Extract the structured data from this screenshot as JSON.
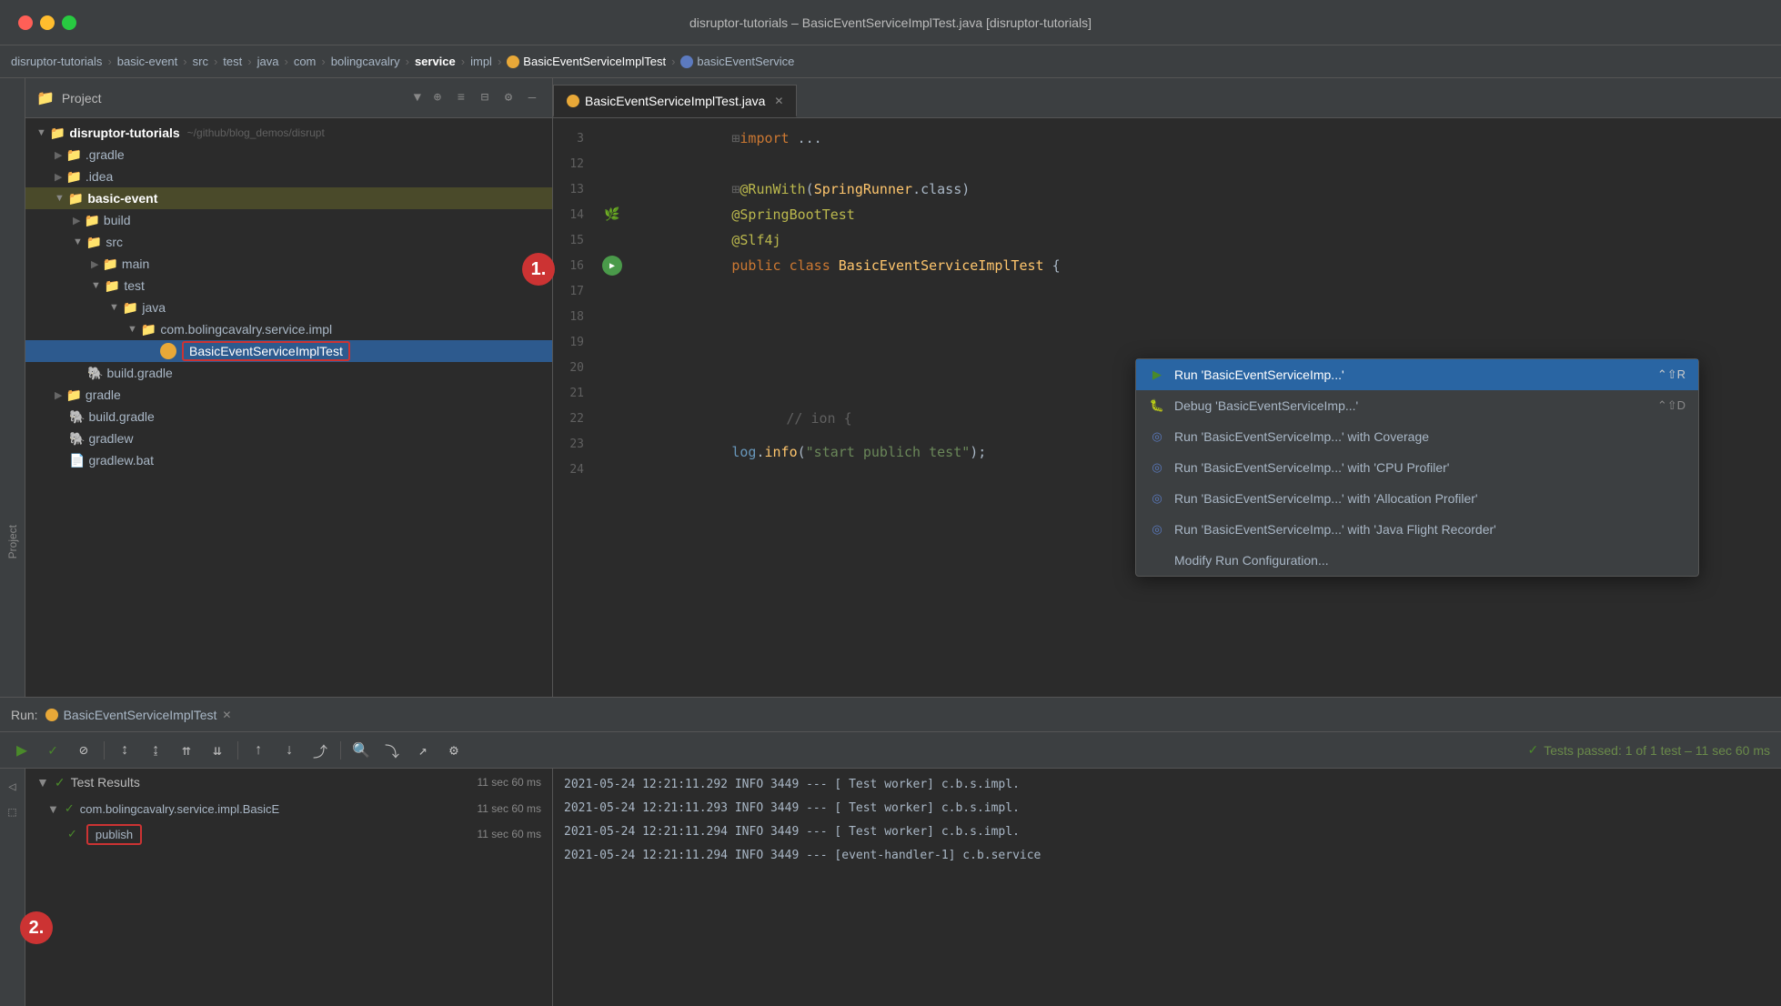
{
  "titlebar": {
    "title": "disruptor-tutorials – BasicEventServiceImplTest.java [disruptor-tutorials]",
    "buttons": {
      "close": "●",
      "minimize": "●",
      "maximize": "●"
    }
  },
  "breadcrumb": {
    "items": [
      "disruptor-tutorials",
      "basic-event",
      "src",
      "test",
      "java",
      "com",
      "bolingcavalry",
      "service",
      "impl",
      "BasicEventServiceImplTest",
      "basicEventService"
    ]
  },
  "sidebar": {
    "header": "Project",
    "tree": [
      {
        "id": "root",
        "indent": 0,
        "arrow": "▼",
        "icon": "📁",
        "label": "disruptor-tutorials",
        "extra": "~/github/blog_demos/disrupt",
        "type": "root"
      },
      {
        "id": "gradle",
        "indent": 1,
        "arrow": "▶",
        "icon": "📁",
        "label": ".gradle",
        "type": "folder"
      },
      {
        "id": "idea",
        "indent": 1,
        "arrow": "▶",
        "icon": "📁",
        "label": ".idea",
        "type": "folder"
      },
      {
        "id": "basic-event",
        "indent": 1,
        "arrow": "▼",
        "icon": "📁",
        "label": "basic-event",
        "type": "folder-bold"
      },
      {
        "id": "build",
        "indent": 2,
        "arrow": "▶",
        "icon": "📁",
        "label": "build",
        "type": "folder"
      },
      {
        "id": "src",
        "indent": 2,
        "arrow": "▼",
        "icon": "📁",
        "label": "src",
        "type": "folder"
      },
      {
        "id": "main",
        "indent": 3,
        "arrow": "▶",
        "icon": "📁",
        "label": "main",
        "type": "folder"
      },
      {
        "id": "test",
        "indent": 3,
        "arrow": "▼",
        "icon": "📁",
        "label": "test",
        "type": "folder"
      },
      {
        "id": "java",
        "indent": 4,
        "arrow": "▼",
        "icon": "📁",
        "label": "java",
        "type": "folder"
      },
      {
        "id": "pkg",
        "indent": 5,
        "arrow": "▼",
        "icon": "📁",
        "label": "com.bolingcavalry.service.impl",
        "type": "folder"
      },
      {
        "id": "testfile",
        "indent": 6,
        "arrow": "",
        "icon": "🔵",
        "label": "BasicEventServiceImplTest",
        "type": "file-selected"
      },
      {
        "id": "build-gradle-inner",
        "indent": 2,
        "arrow": "",
        "icon": "🐘",
        "label": "build.gradle",
        "type": "file"
      },
      {
        "id": "gradle-dir",
        "indent": 1,
        "arrow": "▶",
        "icon": "📁",
        "label": "gradle",
        "type": "folder"
      },
      {
        "id": "build-gradle-root",
        "indent": 1,
        "arrow": "",
        "icon": "🐘",
        "label": "build.gradle",
        "type": "file"
      },
      {
        "id": "gradlew",
        "indent": 1,
        "arrow": "",
        "icon": "📄",
        "label": "gradlew",
        "type": "file"
      },
      {
        "id": "gradlew-bat",
        "indent": 1,
        "arrow": "",
        "icon": "📄",
        "label": "gradlew.bat",
        "type": "file"
      }
    ]
  },
  "editor": {
    "tab": {
      "label": "BasicEventServiceImplTest.java",
      "close": "✕"
    },
    "lines": [
      {
        "num": "3",
        "content": "    ⊞import ...",
        "type": "import"
      },
      {
        "num": "12",
        "content": "",
        "type": "blank"
      },
      {
        "num": "13",
        "content": "    ⊞@RunWith(SpringRunner.class)",
        "type": "annotation"
      },
      {
        "num": "14",
        "content": "    @SpringBootTest",
        "type": "annotation-leaf"
      },
      {
        "num": "15",
        "content": "    @Slf4j",
        "type": "annotation-leaf"
      },
      {
        "num": "16",
        "content": "    public class BasicEventServiceImplTest {",
        "type": "class-decl"
      },
      {
        "num": "17",
        "content": "",
        "type": "blank-menu"
      },
      {
        "num": "18",
        "content": "",
        "type": "blank"
      },
      {
        "num": "19",
        "content": "",
        "type": "blank"
      },
      {
        "num": "20",
        "content": "",
        "type": "blank"
      },
      {
        "num": "21",
        "content": "",
        "type": "blank"
      },
      {
        "num": "22",
        "content": "        // ...",
        "type": "comment-ion"
      },
      {
        "num": "23",
        "content": "            log.info(\"start publich test\");",
        "type": "log"
      },
      {
        "num": "24",
        "content": "",
        "type": "blank"
      }
    ]
  },
  "dropdown": {
    "items": [
      {
        "id": "run",
        "icon": "▶",
        "label": "Run 'BasicEventServiceImp...'",
        "shortcut": "⌃⇧R",
        "selected": true
      },
      {
        "id": "debug",
        "icon": "🐛",
        "label": "Debug 'BasicEventServiceImp...'",
        "shortcut": "⌃⇧D",
        "selected": false
      },
      {
        "id": "run-coverage",
        "icon": "◎",
        "label": "Run 'BasicEventServiceImp...' with Coverage",
        "shortcut": "",
        "selected": false
      },
      {
        "id": "run-cpu",
        "icon": "◎",
        "label": "Run 'BasicEventServiceImp...' with 'CPU Profiler'",
        "shortcut": "",
        "selected": false
      },
      {
        "id": "run-alloc",
        "icon": "◎",
        "label": "Run 'BasicEventServiceImp...' with 'Allocation Profiler'",
        "shortcut": "",
        "selected": false
      },
      {
        "id": "run-flight",
        "icon": "◎",
        "label": "Run 'BasicEventServiceImp...' with 'Java Flight Recorder'",
        "shortcut": "",
        "selected": false
      },
      {
        "id": "modify",
        "icon": "",
        "label": "Modify Run Configuration...",
        "shortcut": "",
        "selected": false
      }
    ]
  },
  "bottom_panel": {
    "run_label": "Run:",
    "run_name": "BasicEventServiceImplTest",
    "run_close": "✕",
    "status": "Tests passed: 1 of 1 test – 11 sec 60 ms",
    "test_results": {
      "header": "Test Results",
      "header_time": "11 sec 60 ms",
      "rows": [
        {
          "id": "root-suite",
          "indent": 0,
          "label": "com.bolingcavalry.service.impl.BasicE",
          "time": "11 sec 60 ms"
        },
        {
          "id": "publish-test",
          "indent": 1,
          "label": "publish",
          "time": "11 sec 60 ms",
          "outlined": true
        }
      ]
    },
    "log_lines": [
      "2021-05-24 12:21:11.292  INFO 3449 ---  [    Test worker] c.b.s.impl.",
      "2021-05-24 12:21:11.293  INFO 3449 ---  [    Test worker] c.b.s.impl.",
      "2021-05-24 12:21:11.294  INFO 3449 ---  [    Test worker] c.b.s.impl.",
      "2021-05-24 12:21:11.294  INFO 3449 ---  [event-handler-1] c.b.service"
    ]
  },
  "steps": {
    "step1": "1.",
    "step2": "2."
  }
}
